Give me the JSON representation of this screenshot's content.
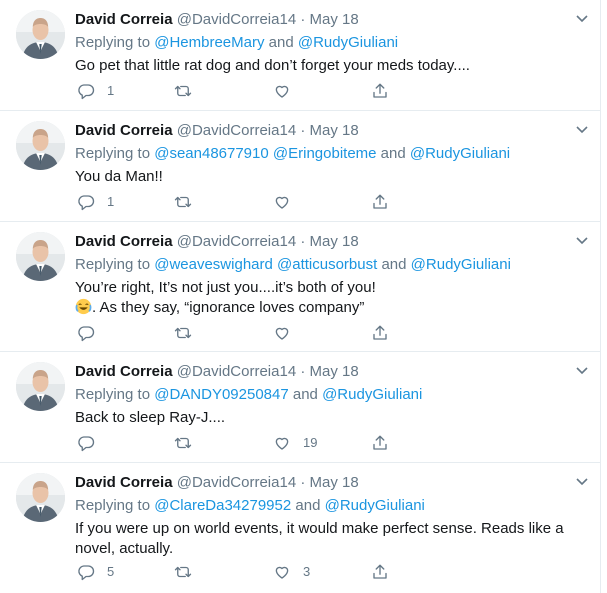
{
  "tweets": [
    {
      "name": "David Correia",
      "handle": "@DavidCorreia14",
      "date": "May 18",
      "replying_label": "Replying to",
      "mentions": [
        "@HembreeMary",
        "@RudyGiuliani"
      ],
      "connector": "and",
      "text": "Go pet that little rat dog and don’t forget your meds today....",
      "reply_count": "1",
      "retweet_count": "",
      "like_count": ""
    },
    {
      "name": "David Correia",
      "handle": "@DavidCorreia14",
      "date": "May 18",
      "replying_label": "Replying to",
      "mentions": [
        "@sean48677910",
        "@Eringobiteme",
        "@RudyGiuliani"
      ],
      "connector": "and",
      "text": "You da Man!!",
      "reply_count": "1",
      "retweet_count": "",
      "like_count": ""
    },
    {
      "name": "David Correia",
      "handle": "@DavidCorreia14",
      "date": "May 18",
      "replying_label": "Replying to",
      "mentions": [
        "@weaveswighard",
        "@atticusorbust",
        "@RudyGiuliani"
      ],
      "connector": "and",
      "text_line1": "You’re right, It’s not just you....it’s both of you!",
      "text_line2": ". As they say, “ignorance loves company”",
      "emoji": "face-with-tears-of-joy",
      "reply_count": "",
      "retweet_count": "",
      "like_count": ""
    },
    {
      "name": "David Correia",
      "handle": "@DavidCorreia14",
      "date": "May 18",
      "replying_label": "Replying to",
      "mentions": [
        "@DANDY09250847",
        "@RudyGiuliani"
      ],
      "connector": "and",
      "text": "Back to sleep Ray-J....",
      "reply_count": "",
      "retweet_count": "",
      "like_count": "19"
    },
    {
      "name": "David Correia",
      "handle": "@DavidCorreia14",
      "date": "May 18",
      "replying_label": "Replying to",
      "mentions": [
        "@ClareDa34279952",
        "@RudyGiuliani"
      ],
      "connector": "and",
      "text_line1": "If you were up on world events, it would make perfect sense. Reads like a",
      "text_line2": "novel, actually.",
      "reply_count": "5",
      "retweet_count": "",
      "like_count": "3"
    }
  ],
  "separator": "·",
  "colors": {
    "link": "#1b95e0",
    "secondary_text": "#657786",
    "divider": "#e6ecf0"
  },
  "icons": [
    "reply-icon",
    "retweet-icon",
    "like-icon",
    "share-icon",
    "chevron-down-icon",
    "avatar"
  ]
}
